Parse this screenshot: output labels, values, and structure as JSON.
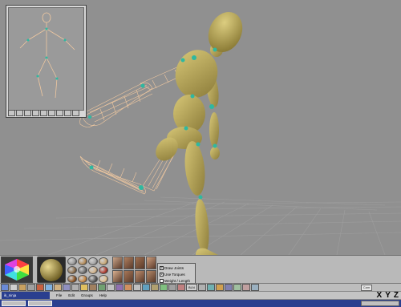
{
  "preview": {
    "toolbar_buttons": [
      "",
      "",
      "",
      "",
      "",
      "",
      "",
      "",
      "",
      ""
    ]
  },
  "options": {
    "draw_joints_label": "Draw Joints",
    "use_torques_label": "Use Torques",
    "weight_length_label": "Weight / Length",
    "draw_joints_checked": true,
    "use_torques_checked": true,
    "weight_length_checked": false
  },
  "materials": {
    "colors": [
      "#9a9a9a",
      "#b58c5a",
      "#a5a5a5",
      "#c9a877",
      "#8a6d4b",
      "#6f6f6f",
      "#d2b48c",
      "#b03a2e",
      "#8d5524",
      "#c68642",
      "#5a5a5a",
      "#e0c090"
    ]
  },
  "textures": {
    "colors": [
      "#c9a58a",
      "#b08060",
      "#a07050",
      "#cfa080",
      "#d8b090",
      "#a87858",
      "#c09070",
      "#b58a6a"
    ]
  },
  "toolbar": {
    "text_button": "BLN"
  },
  "menubar": {
    "app_tab": "ik_ninja",
    "items": [
      "File",
      "Edit",
      "Groups",
      "Help"
    ],
    "camera_label": "Cam",
    "axes": [
      "X",
      "Y",
      "Z"
    ]
  },
  "taskbar": {
    "clock": ""
  },
  "colors": {
    "figure_fill": "#b3a35a",
    "wireframe": "#f0c8a0",
    "joint": "#2fb8a0",
    "viewport_bg": "#909090",
    "taskbar_bg": "#2a3f8f"
  }
}
